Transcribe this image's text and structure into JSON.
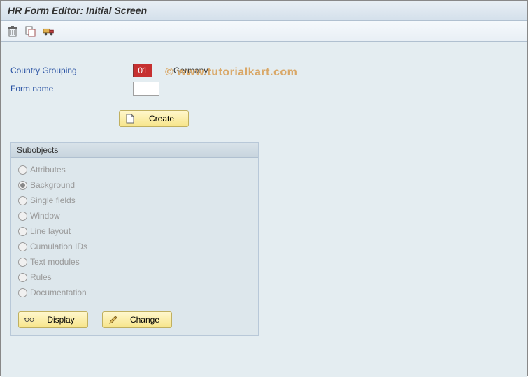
{
  "title": "HR Form Editor: Initial Screen",
  "watermark": "© www.tutorialkart.com",
  "fields": {
    "country_grouping": {
      "label": "Country Grouping",
      "value": "01",
      "text": "Germany"
    },
    "form_name": {
      "label": "Form name",
      "value": ""
    }
  },
  "buttons": {
    "create": "Create",
    "display": "Display",
    "change": "Change"
  },
  "subobjects": {
    "title": "Subobjects",
    "items": [
      {
        "label": "Attributes",
        "selected": false
      },
      {
        "label": "Background",
        "selected": true
      },
      {
        "label": "Single fields",
        "selected": false
      },
      {
        "label": "Window",
        "selected": false
      },
      {
        "label": "Line layout",
        "selected": false
      },
      {
        "label": "Cumulation IDs",
        "selected": false
      },
      {
        "label": "Text modules",
        "selected": false
      },
      {
        "label": "Rules",
        "selected": false
      },
      {
        "label": "Documentation",
        "selected": false
      }
    ]
  }
}
